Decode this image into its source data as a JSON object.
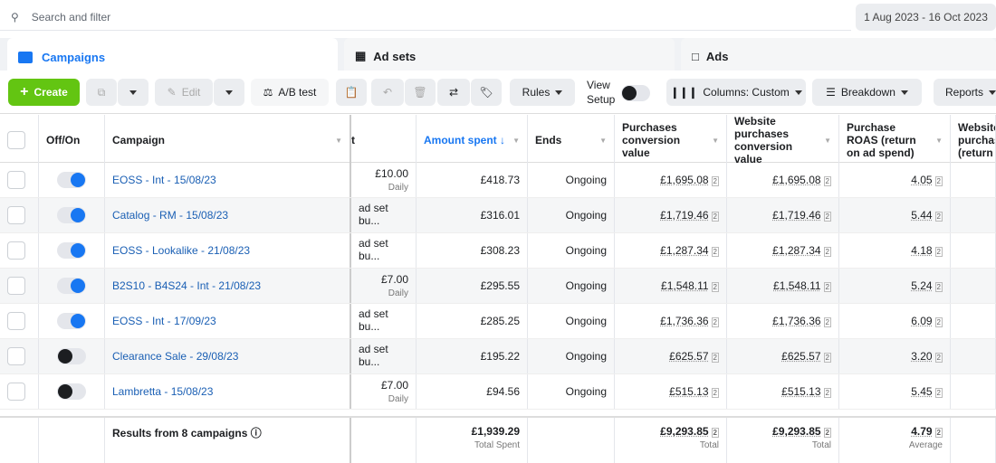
{
  "search": {
    "placeholder": "Search and filter"
  },
  "date_range": "1 Aug 2023 - 16 Oct 2023",
  "tabs": [
    {
      "label": "Campaigns"
    },
    {
      "label": "Ad sets"
    },
    {
      "label": "Ads"
    }
  ],
  "toolbar": {
    "create": "Create",
    "edit": "Edit",
    "ab_test": "A/B test",
    "rules": "Rules",
    "view_setup": "View Setup",
    "columns": "Columns: Custom",
    "breakdown": "Breakdown",
    "reports": "Reports"
  },
  "headers": {
    "off_on": "Off/On",
    "campaign": "Campaign",
    "budget": "t",
    "amount_spent": "Amount spent ↓",
    "ends": "Ends",
    "purchases_conv": "Purchases conversion value",
    "website_purchases_conv": "Website purchases conversion value",
    "roas": "Purchase ROAS (return on ad spend)",
    "website_roas": "Website purchas (return"
  },
  "rows": [
    {
      "on": true,
      "name": "EOSS - Int - 15/08/23",
      "budget": "£10.00",
      "budget_sub": "Daily",
      "spent": "£418.73",
      "ends": "Ongoing",
      "pcv": "£1,695.08",
      "wpcv": "£1,695.08",
      "roas": "4.05"
    },
    {
      "on": true,
      "name": "Catalog - RM - 15/08/23",
      "budget": "ad set bu...",
      "budget_sub": "",
      "spent": "£316.01",
      "ends": "Ongoing",
      "pcv": "£1,719.46",
      "wpcv": "£1,719.46",
      "roas": "5.44"
    },
    {
      "on": true,
      "name": "EOSS - Lookalike - 21/08/23",
      "budget": "ad set bu...",
      "budget_sub": "",
      "spent": "£308.23",
      "ends": "Ongoing",
      "pcv": "£1,287.34",
      "wpcv": "£1,287.34",
      "roas": "4.18"
    },
    {
      "on": true,
      "name": "B2S10 - B4S24 - Int - 21/08/23",
      "budget": "£7.00",
      "budget_sub": "Daily",
      "spent": "£295.55",
      "ends": "Ongoing",
      "pcv": "£1,548.11",
      "wpcv": "£1,548.11",
      "roas": "5.24"
    },
    {
      "on": true,
      "name": "EOSS - Int - 17/09/23",
      "budget": "ad set bu...",
      "budget_sub": "",
      "spent": "£285.25",
      "ends": "Ongoing",
      "pcv": "£1,736.36",
      "wpcv": "£1,736.36",
      "roas": "6.09"
    },
    {
      "on": false,
      "name": "Clearance Sale - 29/08/23",
      "budget": "ad set bu...",
      "budget_sub": "",
      "spent": "£195.22",
      "ends": "Ongoing",
      "pcv": "£625.57",
      "wpcv": "£625.57",
      "roas": "3.20"
    },
    {
      "on": false,
      "name": "Lambretta - 15/08/23",
      "budget": "£7.00",
      "budget_sub": "Daily",
      "spent": "£94.56",
      "ends": "Ongoing",
      "pcv": "£515.13",
      "wpcv": "£515.13",
      "roas": "5.45"
    }
  ],
  "attribution_marker": "2",
  "footer": {
    "label": "Results from 8 campaigns",
    "spent": "£1,939.29",
    "spent_sub": "Total Spent",
    "pcv": "£9,293.85",
    "pcv_sub": "Total",
    "wpcv": "£9,293.85",
    "wpcv_sub": "Total",
    "roas": "4.79",
    "roas_sub": "Average"
  }
}
